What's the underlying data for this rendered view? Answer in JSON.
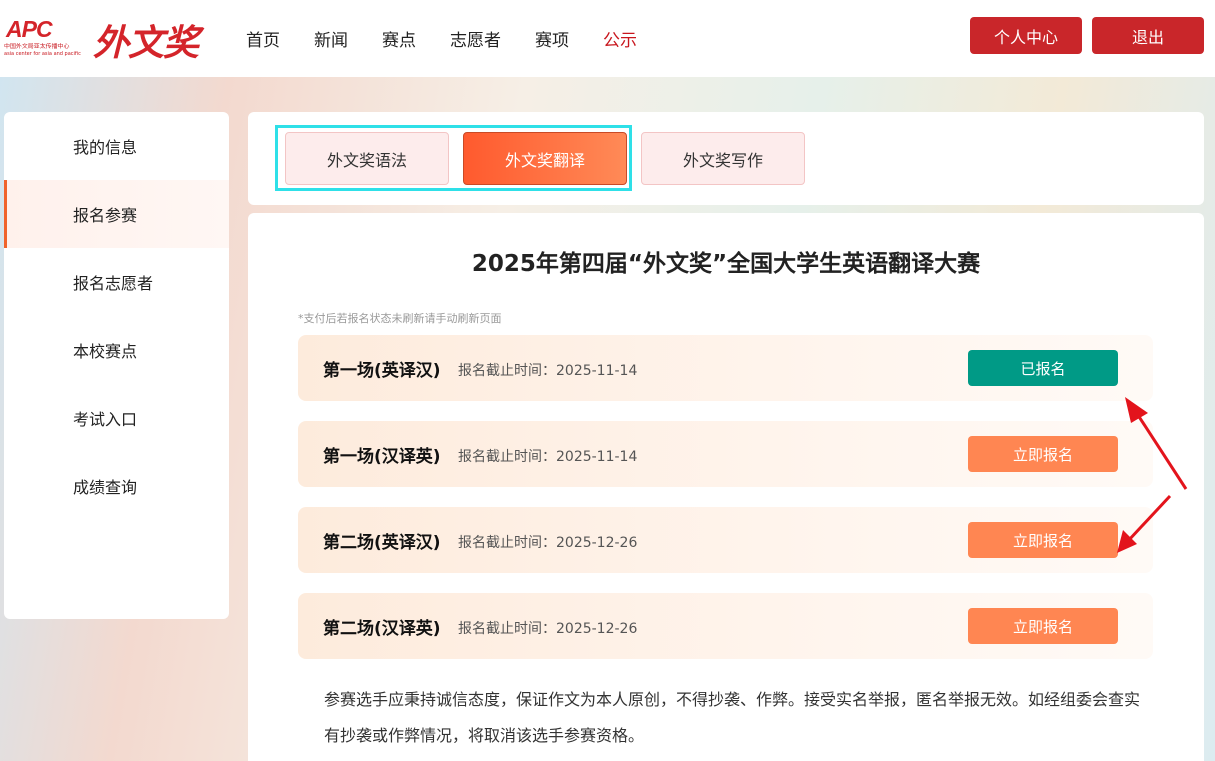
{
  "header": {
    "logo_text": "APC",
    "logo_cn": "中国外文局亚太传播中心",
    "logo_en": "asia center for asia and pacific",
    "brand": "外文奖",
    "nav": [
      {
        "label": "首页"
      },
      {
        "label": "新闻"
      },
      {
        "label": "赛点"
      },
      {
        "label": "志愿者"
      },
      {
        "label": "赛项"
      },
      {
        "label": "公示",
        "active": true
      }
    ],
    "personal_center": "个人中心",
    "logout": "退出"
  },
  "sidebar": {
    "items": [
      {
        "label": "我的信息"
      },
      {
        "label": "报名参赛",
        "active": true
      },
      {
        "label": "报名志愿者"
      },
      {
        "label": "本校赛点"
      },
      {
        "label": "考试入口"
      },
      {
        "label": "成绩查询"
      }
    ]
  },
  "tabs": [
    {
      "label": "外文奖语法"
    },
    {
      "label": "外文奖翻译",
      "active": true
    },
    {
      "label": "外文奖写作"
    }
  ],
  "main": {
    "title": "2025年第四届“外文奖”全国大学生英语翻译大赛",
    "notice": "*支付后若报名状态未刷新请手动刷新页面",
    "sessions": [
      {
        "name": "第一场(英译汉)",
        "deadline": "报名截止时间：2025-11-14",
        "button": "已报名",
        "status": "registered"
      },
      {
        "name": "第一场(汉译英)",
        "deadline": "报名截止时间：2025-11-14",
        "button": "立即报名",
        "status": "open"
      },
      {
        "name": "第二场(英译汉)",
        "deadline": "报名截止时间：2025-12-26",
        "button": "立即报名",
        "status": "open"
      },
      {
        "name": "第二场(汉译英)",
        "deadline": "报名截止时间：2025-12-26",
        "button": "立即报名",
        "status": "open"
      }
    ],
    "rules": "参赛选手应秉持诚信态度，保证作文为本人原创，不得抄袭、作弊。接受实名举报，匿名举报无效。如经组委会查实有抄袭或作弊情况，将取消该选手参赛资格。"
  },
  "colors": {
    "brand_red": "#c9262a",
    "accent_orange": "#ff8652",
    "registered_green": "#009a86",
    "annotation_red": "#e3141c",
    "highlight_cyan": "#2ee0e8"
  }
}
